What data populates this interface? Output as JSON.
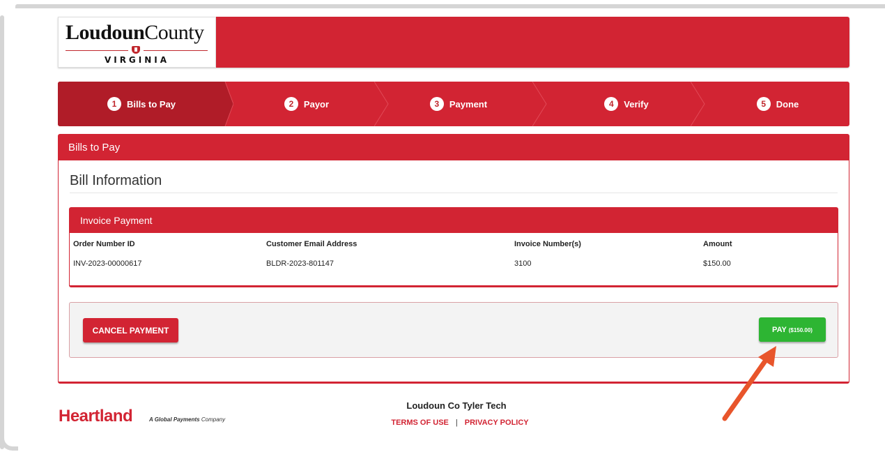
{
  "logo": {
    "main_bold": "Loudoun",
    "main_rest": "County",
    "sub": "VIRGINIA"
  },
  "steps": [
    {
      "num": "1",
      "label": "Bills to Pay",
      "active": true
    },
    {
      "num": "2",
      "label": "Payor",
      "active": false
    },
    {
      "num": "3",
      "label": "Payment",
      "active": false
    },
    {
      "num": "4",
      "label": "Verify",
      "active": false
    },
    {
      "num": "5",
      "label": "Done",
      "active": false
    }
  ],
  "panel": {
    "title": "Bills to Pay",
    "section_title": "Bill Information"
  },
  "invoice": {
    "title": "Invoice Payment",
    "columns": [
      "Order Number ID",
      "Customer Email Address",
      "Invoice Number(s)",
      "Amount"
    ],
    "row": [
      "INV-2023-00000617",
      "BLDR-2023-801147",
      "3100",
      "$150.00"
    ]
  },
  "actions": {
    "cancel_label": "CANCEL PAYMENT",
    "pay_label": "PAY",
    "pay_amount": "($150.00)"
  },
  "footer": {
    "brand": "Heartland",
    "tagline_bold": "A Global Payments",
    "tagline_rest": "Company",
    "title": "Loudoun Co Tyler Tech",
    "terms": "TERMS OF USE",
    "separator": "|",
    "privacy": "PRIVACY POLICY"
  },
  "colors": {
    "brand_red": "#d22433",
    "active_step": "#b01c28",
    "pay_green": "#2db533",
    "annotation_arrow": "#e8552b"
  }
}
